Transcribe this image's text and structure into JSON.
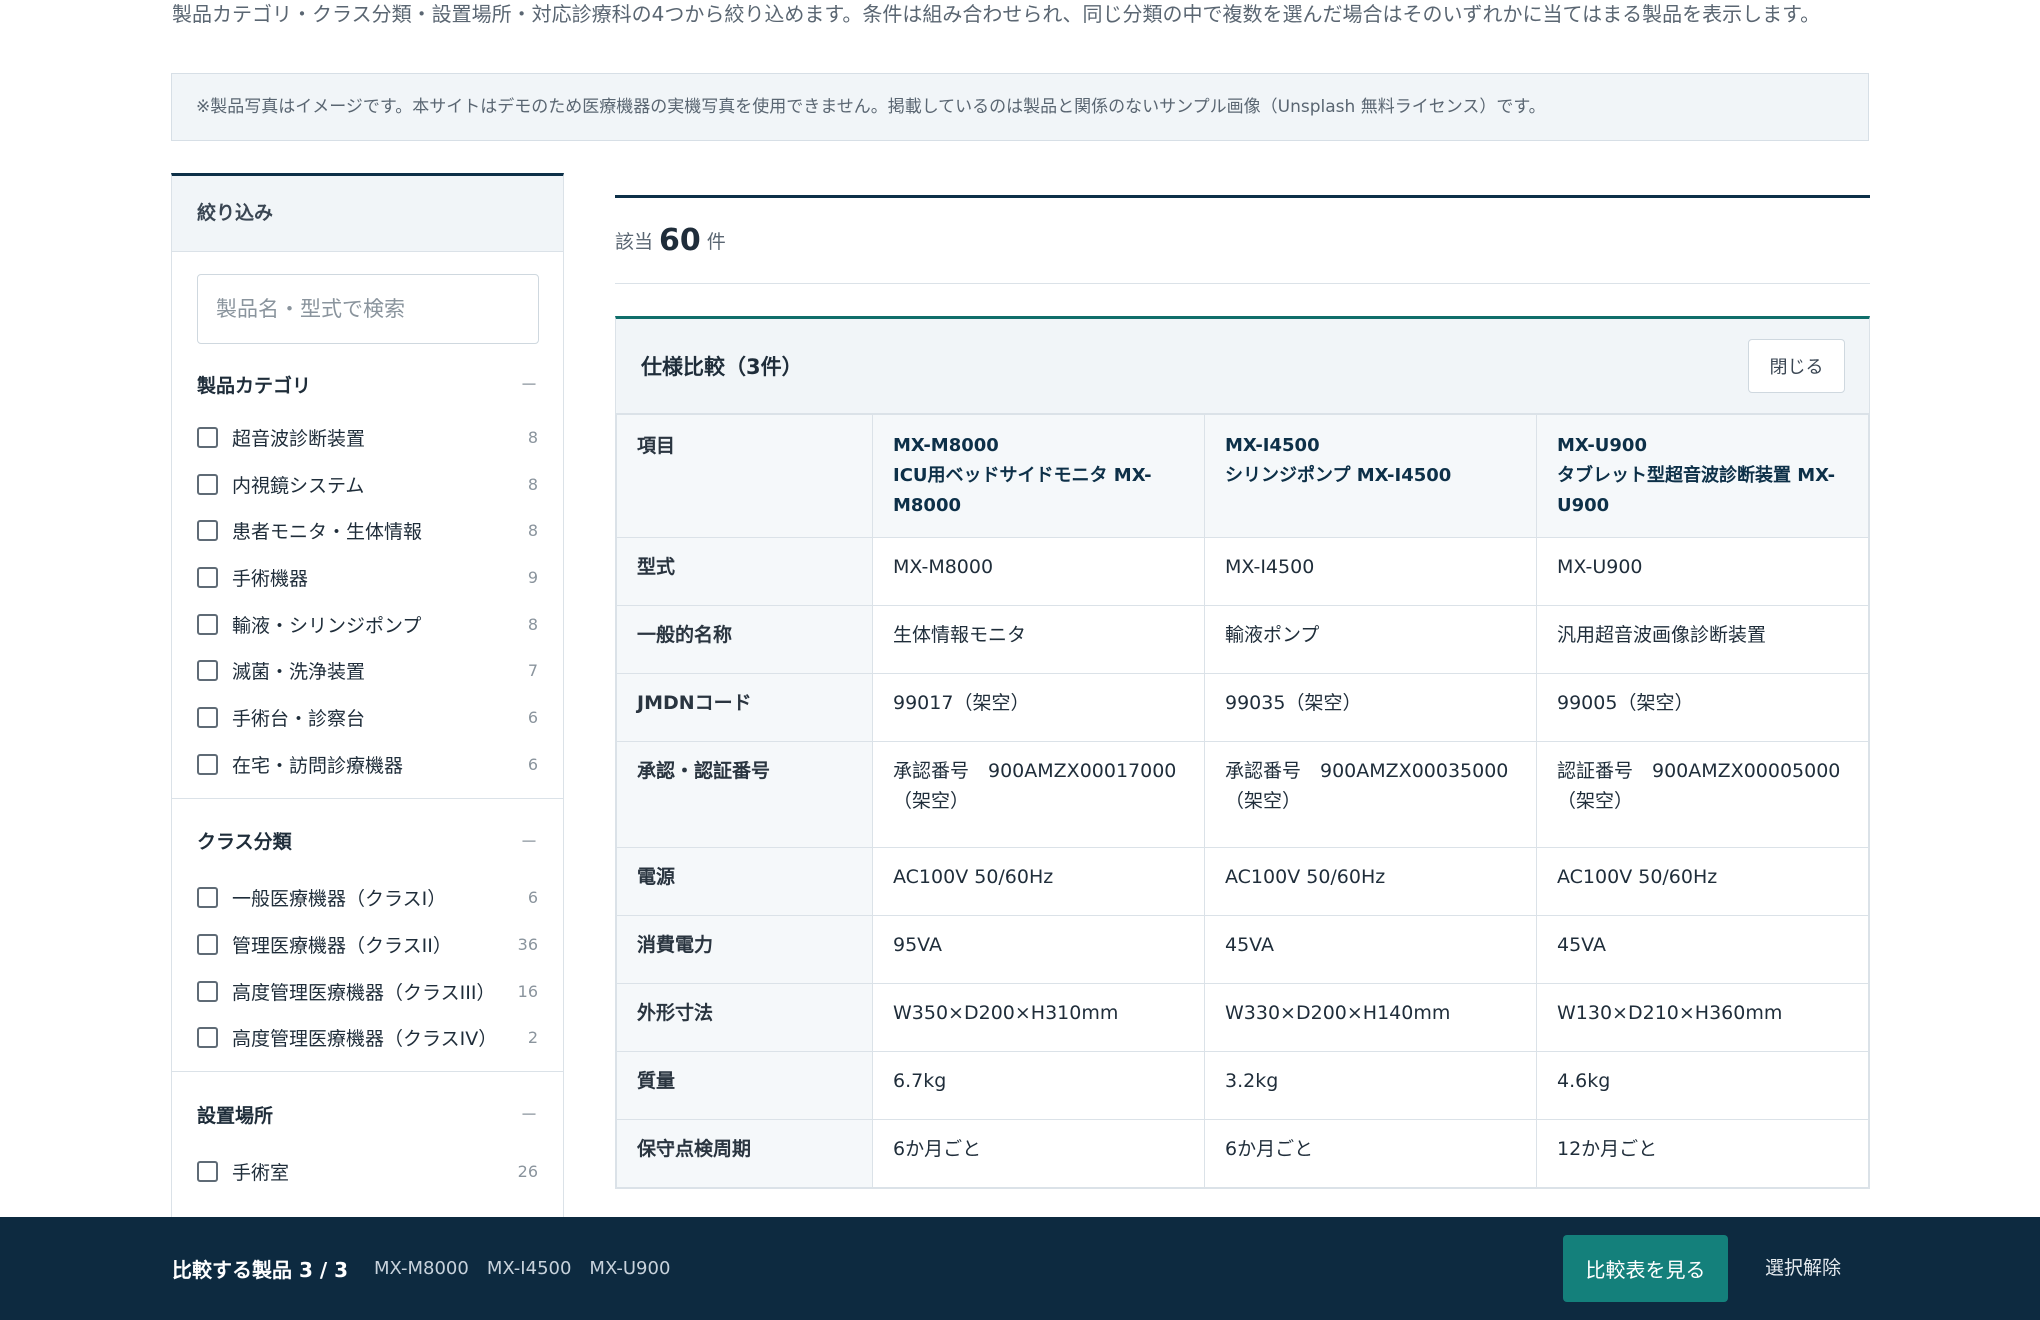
{
  "intro": "製品カテゴリ・クラス分類・設置場所・対応診療科の4つから絞り込めます。条件は組み合わせられ、同じ分類の中で複数を選んだ場合はそのいずれかに当てはまる製品を表示します。",
  "notice": "※製品写真はイメージです。本サイトはデモのため医療機器の実機写真を使用できません。掲載しているのは製品と関係のないサンプル画像（Unsplash 無料ライセンス）です。",
  "sidebar": {
    "title": "絞り込み",
    "search_placeholder": "製品名・型式で検索",
    "collapse_symbol": "－",
    "categories": {
      "title": "製品カテゴリ",
      "options": [
        {
          "label": "超音波診断装置",
          "count": "8"
        },
        {
          "label": "内視鏡システム",
          "count": "8"
        },
        {
          "label": "患者モニタ・生体情報",
          "count": "8"
        },
        {
          "label": "手術機器",
          "count": "9"
        },
        {
          "label": "輸液・シリンジポンプ",
          "count": "8"
        },
        {
          "label": "滅菌・洗浄装置",
          "count": "7"
        },
        {
          "label": "手術台・診察台",
          "count": "6"
        },
        {
          "label": "在宅・訪問診療機器",
          "count": "6"
        }
      ]
    },
    "classes": {
      "title": "クラス分類",
      "options": [
        {
          "label": "一般医療機器（クラスI）",
          "count": "6"
        },
        {
          "label": "管理医療機器（クラスII）",
          "count": "36"
        },
        {
          "label": "高度管理医療機器（クラスIII）",
          "count": "16"
        },
        {
          "label": "高度管理医療機器（クラスIV）",
          "count": "2"
        }
      ]
    },
    "locations": {
      "title": "設置場所",
      "options": [
        {
          "label": "手術室",
          "count": "26"
        }
      ]
    }
  },
  "results": {
    "prefix": "該当",
    "count": "60",
    "suffix": "件"
  },
  "compare": {
    "title": "仕様比較（3件）",
    "close_label": "閉じる",
    "header_item": "項目",
    "products": [
      {
        "code": "MX-M8000",
        "name": "ICU用ベッドサイドモニタ MX-M8000"
      },
      {
        "code": "MX-I4500",
        "name": "シリンジポンプ MX-I4500"
      },
      {
        "code": "MX-U900",
        "name": "タブレット型超音波診断装置 MX-U900"
      }
    ],
    "rows": [
      {
        "label": "型式",
        "values": [
          "MX-M8000",
          "MX-I4500",
          "MX-U900"
        ]
      },
      {
        "label": "一般的名称",
        "values": [
          "生体情報モニタ",
          "輸液ポンプ",
          "汎用超音波画像診断装置"
        ]
      },
      {
        "label": "JMDNコード",
        "values": [
          "99017（架空）",
          "99035（架空）",
          "99005（架空）"
        ]
      },
      {
        "label": "承認・認証番号",
        "values": [
          "承認番号　900AMZX00017000（架空）",
          "承認番号　900AMZX00035000（架空）",
          "認証番号　900AMZX00005000（架空）"
        ]
      },
      {
        "label": "電源",
        "values": [
          "AC100V 50/60Hz",
          "AC100V 50/60Hz",
          "AC100V 50/60Hz"
        ]
      },
      {
        "label": "消費電力",
        "values": [
          "95VA",
          "45VA",
          "45VA"
        ]
      },
      {
        "label": "外形寸法",
        "values": [
          "W350×D200×H310mm",
          "W330×D200×H140mm",
          "W130×D210×H360mm"
        ]
      },
      {
        "label": "質量",
        "values": [
          "6.7kg",
          "3.2kg",
          "4.6kg"
        ]
      },
      {
        "label": "保守点検周期",
        "values": [
          "6か月ごと",
          "6か月ごと",
          "12か月ごと"
        ]
      }
    ]
  },
  "bottom_bar": {
    "title": "比較する製品 3 / 3",
    "items": [
      "MX-M8000",
      "MX-I4500",
      "MX-U900"
    ],
    "view_label": "比較表を見る",
    "clear_label": "選択解除"
  }
}
